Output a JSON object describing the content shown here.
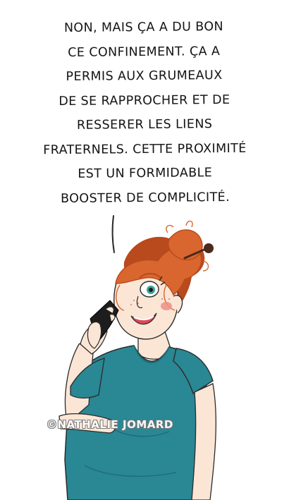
{
  "caption": {
    "lines": [
      "NON, MAIS ÇA A DU BON",
      "CE CONFINEMENT. ÇA A",
      "PERMIS AUX GRUMEAUX",
      "DE SE RAPPROCHER ET DE",
      "RESSERER LES LIENS",
      "FRATERNELS. CETTE PROXIMITÉ",
      "EST UN FORMIDABLE",
      "BOOSTER DE COMPLICITÉ."
    ]
  },
  "watermark": {
    "text": "©NATHALIE JOMARD"
  },
  "illustration": {
    "subject": "woman-on-phone",
    "colors": {
      "hair": "#d9662f",
      "hair_dark": "#b84a1e",
      "skin": "#fbe6d6",
      "shirt": "#2a8794",
      "shirt_dark": "#1e6c77",
      "phone": "#1d1d1d",
      "lips": "#e0475a",
      "eye": "#3aa596",
      "blush": "#ef8e86",
      "hair_stick": "#4a2a1c",
      "outline": "#2b2b2b"
    }
  }
}
